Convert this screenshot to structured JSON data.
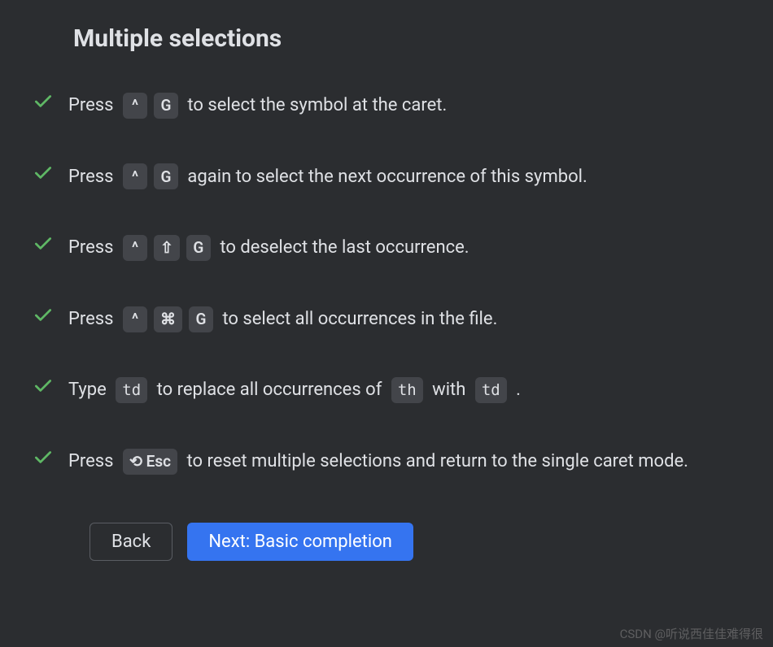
{
  "title": "Multiple selections",
  "keys": {
    "ctrl": "^",
    "shift": "⇧",
    "cmd": "⌘",
    "g": "G",
    "reset": "⟲ Esc",
    "td": "td",
    "th": "th"
  },
  "steps": {
    "s1": {
      "pre": "Press ",
      "post": " to select the symbol at the caret."
    },
    "s2": {
      "pre": "Press ",
      "post": " again to select the next occurrence of this symbol."
    },
    "s3": {
      "pre": "Press ",
      "post": " to deselect the last occurrence."
    },
    "s4": {
      "pre": "Press ",
      "post": " to select all occurrences in the file."
    },
    "s5": {
      "pre": "Type ",
      "mid1": " to replace all occurrences of ",
      "mid2": " with ",
      "post": " ."
    },
    "s6": {
      "pre": "Press ",
      "post": " to reset multiple selections and return to the single caret mode."
    }
  },
  "buttons": {
    "back": "Back",
    "next": "Next: Basic completion"
  },
  "watermark": "CSDN @听说西佳佳难得很"
}
